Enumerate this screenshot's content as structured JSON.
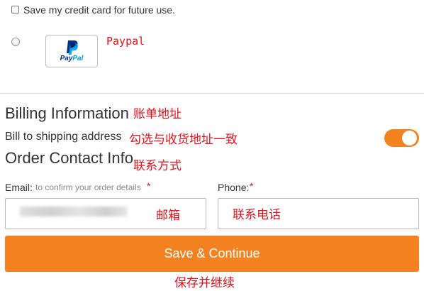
{
  "payment": {
    "save_card_label": "Save my credit card for future use.",
    "paypal_option": {
      "logo_text_pay": "Pay",
      "logo_text_pal": "Pal",
      "annotation": "Paypal"
    }
  },
  "billing": {
    "title": "Billing Information",
    "title_annotation": "账单地址",
    "bill_to_shipping_label": "Bill to shipping address",
    "bill_to_shipping_annotation": "勾选与收货地址一致",
    "bill_to_shipping_enabled": true
  },
  "contact": {
    "title": "Order Contact Info",
    "title_annotation": "联系方式",
    "email": {
      "label": "Email:",
      "hint": "to confirm your order details",
      "required_mark": "*",
      "annotation": "邮箱"
    },
    "phone": {
      "label": "Phone:",
      "required_mark": "*",
      "annotation": "联系电话"
    }
  },
  "actions": {
    "save_continue_label": "Save & Continue",
    "save_continue_annotation": "保存并继续"
  },
  "colors": {
    "accent_orange": "#f58220",
    "annotation_red": "#e8111b",
    "paypal_dark_blue": "#003087",
    "paypal_light_blue": "#009cde"
  }
}
